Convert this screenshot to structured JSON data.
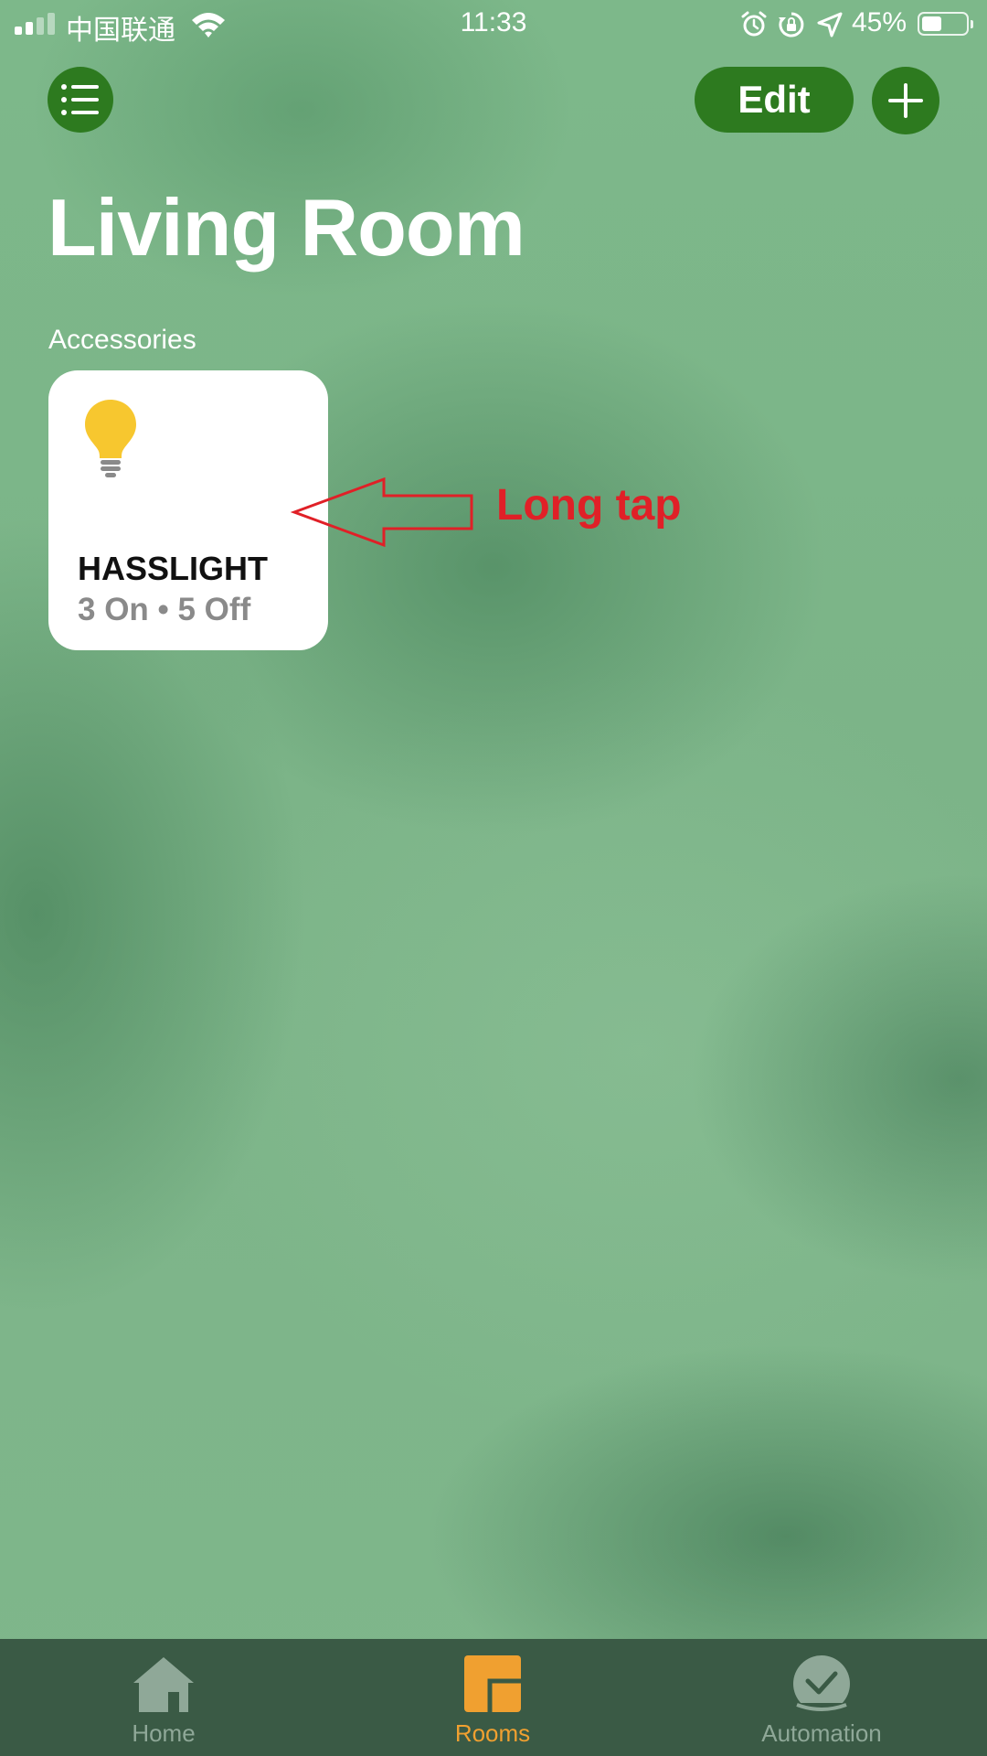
{
  "status_bar": {
    "carrier": "中国联通",
    "time": "11:33",
    "battery_percent": "45%",
    "battery_level": 0.45,
    "icons": [
      "signal-icon",
      "wifi-icon",
      "alarm-icon",
      "orientation-lock-icon",
      "location-icon",
      "battery-icon"
    ]
  },
  "header": {
    "menu_icon": "list-icon",
    "edit_label": "Edit",
    "add_icon": "plus-icon",
    "accent_color": "#2d7a1f"
  },
  "page": {
    "title": "Living Room",
    "section_label": "Accessories"
  },
  "accessories": [
    {
      "name": "HASSLIGHT",
      "status": "3 On • 5 Off",
      "icon": "lightbulb-icon",
      "icon_color": "#f7c72f"
    }
  ],
  "annotation": {
    "label": "Long tap",
    "color": "#e02027"
  },
  "tab_bar": {
    "active_color": "#f0a030",
    "tabs": [
      {
        "label": "Home",
        "icon": "house-icon",
        "active": false
      },
      {
        "label": "Rooms",
        "icon": "rooms-icon",
        "active": true
      },
      {
        "label": "Automation",
        "icon": "checkmark-clock-icon",
        "active": false
      }
    ]
  }
}
